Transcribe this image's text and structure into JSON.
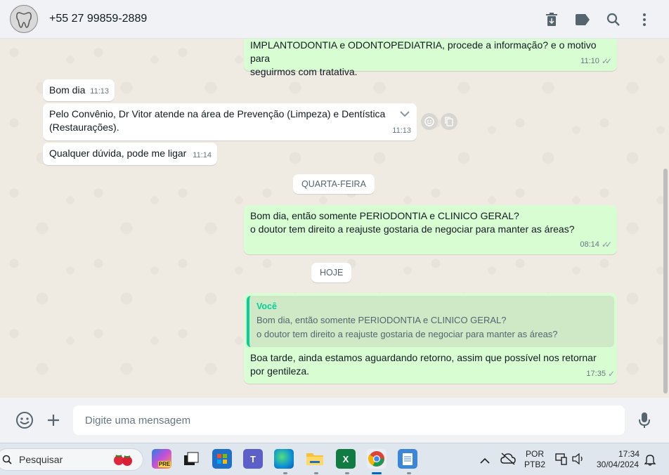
{
  "header": {
    "contact": "+55 27 99859-2889",
    "actions": [
      "delete-icon",
      "label-icon",
      "search-icon",
      "menu-icon"
    ]
  },
  "messages": [
    {
      "id": "m1",
      "dir": "out",
      "text_line1": "IMPLANTODONTIA e ODONTOPEDIATRIA, procede a informação? e o motivo para",
      "text_line2": "seguirmos com tratativa.",
      "time": "11:10",
      "status": "read"
    },
    {
      "id": "m2",
      "dir": "in",
      "text": "Bom dia",
      "time": "11:13"
    },
    {
      "id": "m3",
      "dir": "in",
      "text_line1": "Pelo Convênio, Dr Vitor atende na área de Prevenção (Limpeza) e Dentística",
      "text_line2": "(Restaurações).",
      "time": "11:13"
    },
    {
      "id": "m4",
      "dir": "in",
      "text": "Qualquer dúvida, pode me ligar",
      "time": "11:14"
    },
    {
      "id": "m5",
      "dir": "out",
      "text_line1": "Bom dia, então somente PERIODONTIA e CLINICO GERAL?",
      "text_line2": "o doutor tem direito a reajuste gostaria de negociar para manter as áreas?",
      "time": "08:14",
      "status": "read"
    },
    {
      "id": "m6",
      "dir": "out",
      "quote_author": "Você",
      "quote_line1": "Bom dia, então somente PERIODONTIA e CLINICO GERAL?",
      "quote_line2": "o doutor tem direito a reajuste gostaria de negociar para manter as áreas?",
      "text_line1": "Boa tarde, ainda estamos aguardando retorno, assim que possível nos retornar",
      "text_line2": "por gentileza.",
      "time": "17:35",
      "status": "sent"
    }
  ],
  "day_separators": {
    "wednesday": "QUARTA-FEIRA",
    "today": "HOJE"
  },
  "composer": {
    "placeholder": "Digite uma mensagem"
  },
  "taskbar": {
    "search_placeholder": "Pesquisar",
    "apps": [
      "Copilot",
      "Widgets",
      "Microsoft Store",
      "Teams",
      "Edge",
      "File Explorer",
      "Excel",
      "Chrome",
      "Notepad"
    ],
    "lang_line1": "POR",
    "lang_line2": "PTB2",
    "time": "17:34",
    "date": "30/04/2024"
  },
  "colors": {
    "outgoing": "#d9fdd3",
    "incoming": "#ffffff",
    "accent": "#06cf9c"
  }
}
